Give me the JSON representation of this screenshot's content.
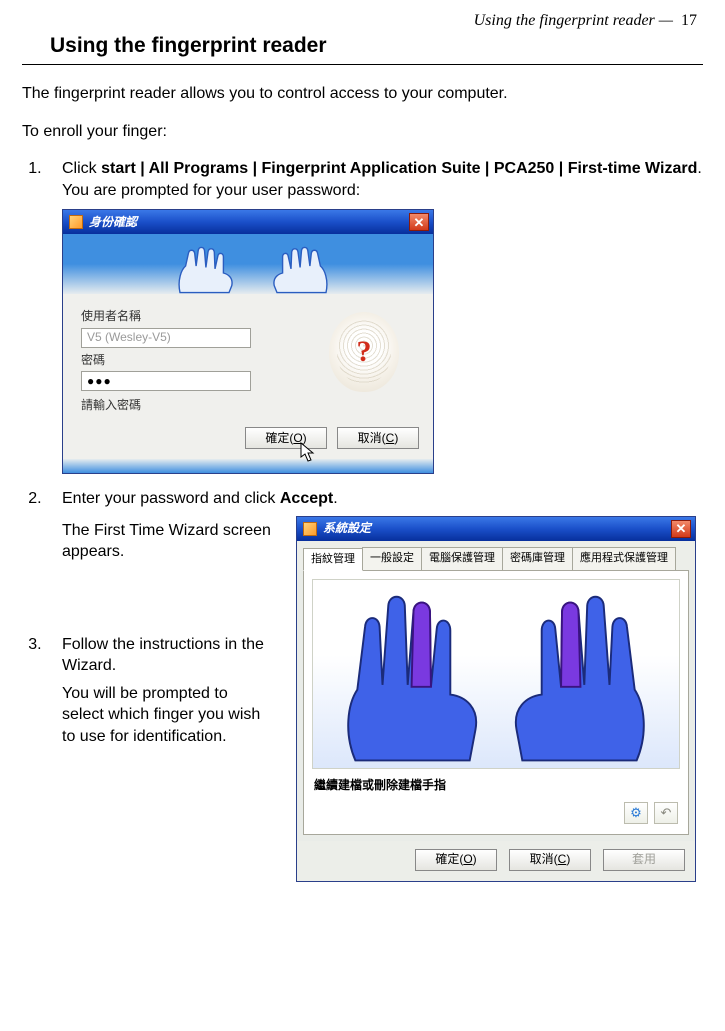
{
  "header": {
    "running_title": "Using the fingerprint reader —",
    "page_number": "17",
    "section_title": "Using the fingerprint reader"
  },
  "intro": "The fingerprint reader allows you to control access to your computer.",
  "enroll_lead": "To enroll your finger:",
  "steps": {
    "s1_prefix": "Click ",
    "s1_bold": "start | All Programs | Fingerprint Application Suite | PCA250 | First-time Wizard",
    "s1_suffix": ". You are prompted for your user password:",
    "s2_prefix": "Enter your password and click ",
    "s2_bold": "Accept",
    "s2_suffix": ".",
    "s2_sub": "The First Time Wizard screen appears.",
    "s3": "Follow the instructions in the Wizard.",
    "s3_sub": "You will be prompted to select which finger you wish to use for identifica­tion."
  },
  "dlg1": {
    "title": "身份確認",
    "label_user": "使用者名稱",
    "value_user": "V5 (Wesley-V5)",
    "label_pw": "密碼",
    "value_pw": "●●●",
    "prompt": "請輸入密碼",
    "qmark": "?",
    "btn_ok_text": "確定(",
    "btn_ok_key": "O",
    "btn_ok_close": ")",
    "btn_cancel_text": "取消(",
    "btn_cancel_key": "C",
    "btn_cancel_close": ")"
  },
  "dlg2": {
    "title": "系統設定",
    "tabs": [
      "指紋管理",
      "一般設定",
      "電腦保護管理",
      "密碼庫管理",
      "應用程式保護管理"
    ],
    "instruction": "繼續建檔或刪除建檔手指",
    "mini1": "⚙",
    "mini2": "↶",
    "btn_ok_text": "確定(",
    "btn_ok_key": "O",
    "btn_ok_close": ")",
    "btn_cancel_text": "取消(",
    "btn_cancel_key": "C",
    "btn_cancel_close": ")",
    "btn_apply": "套用"
  }
}
